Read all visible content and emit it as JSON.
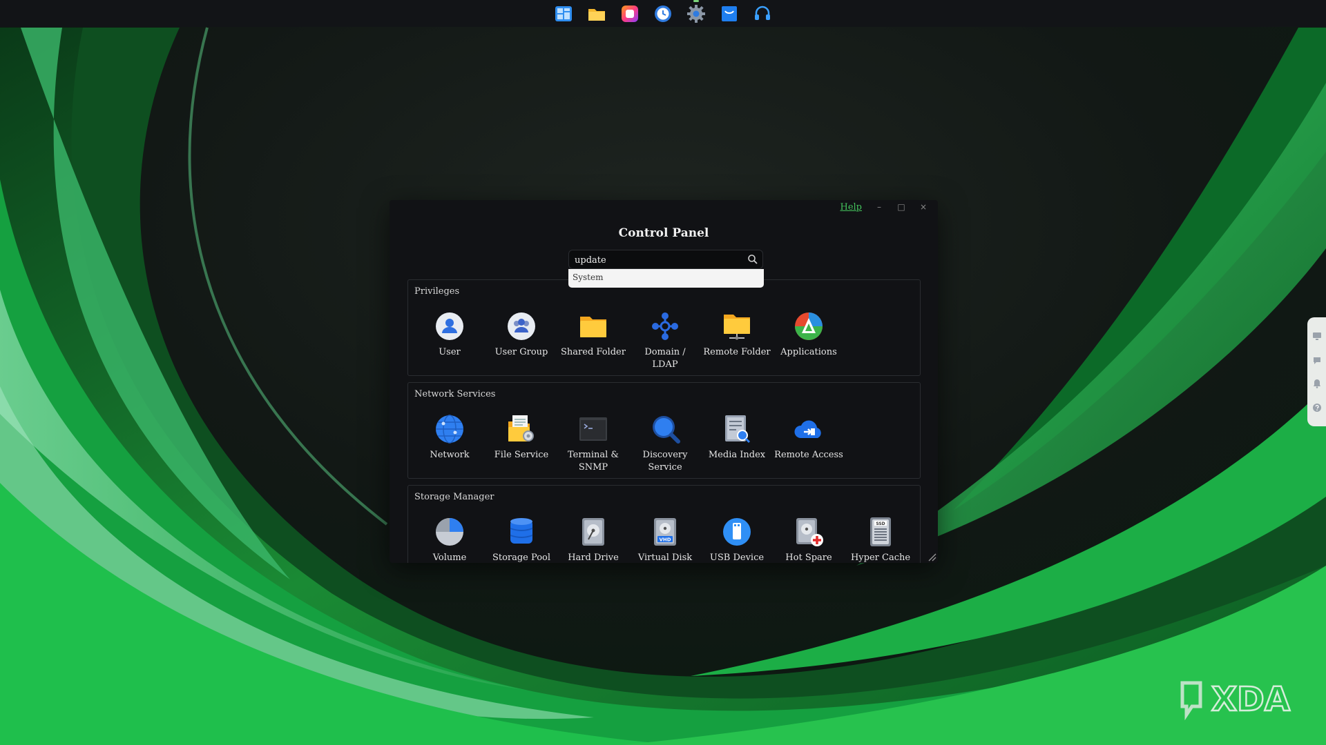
{
  "taskbar": {
    "apps": [
      {
        "icon": "dashboard-icon"
      },
      {
        "icon": "folder-icon"
      },
      {
        "icon": "photo-app-icon"
      },
      {
        "icon": "clock-icon"
      },
      {
        "icon": "settings-gear-icon"
      },
      {
        "icon": "store-bag-icon"
      },
      {
        "icon": "headset-support-icon"
      }
    ]
  },
  "window": {
    "title": "Control Panel",
    "help_label": "Help",
    "minimize_label": "–",
    "maximize_label": "□",
    "close_label": "×",
    "search": {
      "value": "update"
    },
    "dropdown": {
      "suggestion": "System"
    },
    "sections": {
      "privileges": {
        "title": "Privileges",
        "items": [
          {
            "label": "User",
            "icon": "user-icon"
          },
          {
            "label": "User Group",
            "icon": "user-group-icon"
          },
          {
            "label": "Shared Folder",
            "icon": "shared-folder-icon"
          },
          {
            "label": "Domain / LDAP",
            "icon": "domain-ldap-icon"
          },
          {
            "label": "Remote Folder",
            "icon": "remote-folder-icon"
          },
          {
            "label": "Applications",
            "icon": "applications-icon"
          }
        ]
      },
      "network": {
        "title": "Network Services",
        "items": [
          {
            "label": "Network",
            "icon": "network-globe-icon"
          },
          {
            "label": "File Service",
            "icon": "file-service-icon"
          },
          {
            "label": "Terminal & SNMP",
            "icon": "terminal-icon"
          },
          {
            "label": "Discovery Service",
            "icon": "discovery-magnifier-icon"
          },
          {
            "label": "Media Index",
            "icon": "media-index-icon"
          },
          {
            "label": "Remote Access",
            "icon": "remote-access-cloud-icon"
          }
        ]
      },
      "storage": {
        "title": "Storage Manager",
        "items": [
          {
            "label": "Volume",
            "icon": "volume-pie-icon"
          },
          {
            "label": "Storage Pool",
            "icon": "storage-pool-icon"
          },
          {
            "label": "Hard Drive",
            "icon": "hard-drive-icon"
          },
          {
            "label": "Virtual Disk",
            "icon": "virtual-disk-icon",
            "badge": "VHD"
          },
          {
            "label": "USB Device",
            "icon": "usb-device-icon"
          },
          {
            "label": "Hot Spare",
            "icon": "hot-spare-icon"
          },
          {
            "label": "Hyper Cache",
            "icon": "hyper-cache-ssd-icon",
            "badge": "SSD"
          }
        ]
      }
    }
  },
  "side_panel": {
    "icons": [
      "monitor-icon",
      "chat-icon",
      "bell-icon",
      "help-icon"
    ]
  },
  "watermark": {
    "text": "XDA"
  },
  "colors": {
    "accent_green": "#44c25c",
    "window_bg": "#111215",
    "taskbar_bg": "#121417"
  }
}
